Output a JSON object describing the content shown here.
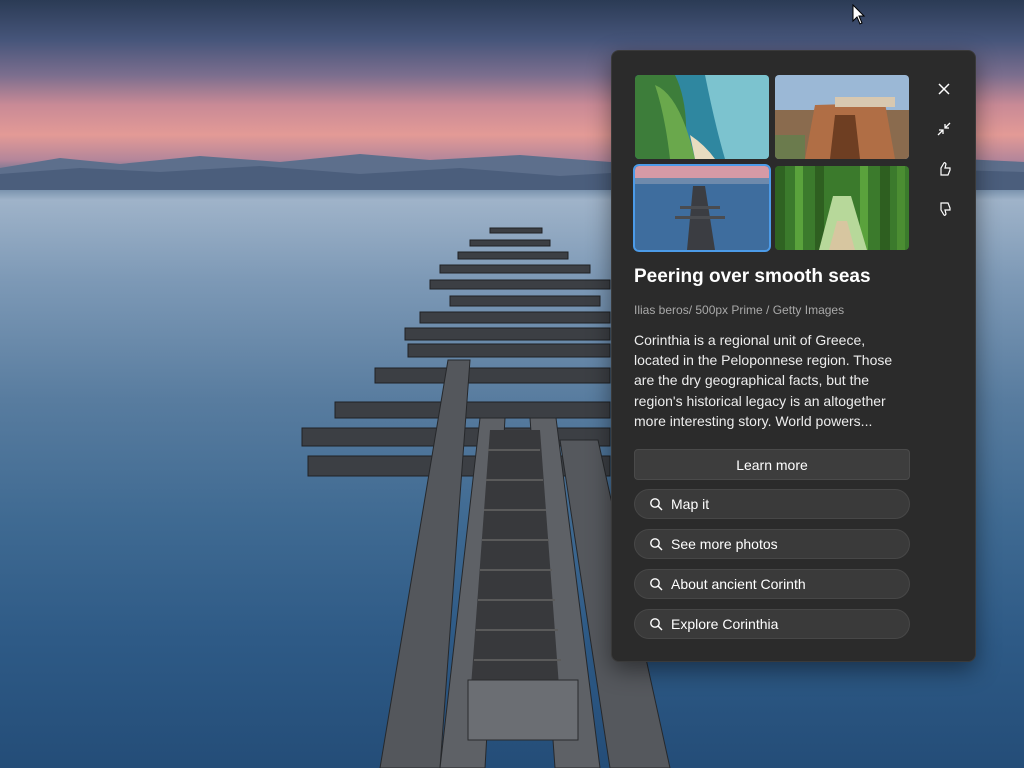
{
  "spotlight": {
    "thumbnails": [
      {
        "name": "coastline",
        "selected": false
      },
      {
        "name": "cliff-town",
        "selected": false
      },
      {
        "name": "pier-seascape",
        "selected": true
      },
      {
        "name": "bamboo-forest",
        "selected": false
      }
    ],
    "side_actions": [
      "close-icon",
      "collapse-icon",
      "thumbs-up-icon",
      "thumbs-down-icon"
    ],
    "title": "Peering over smooth seas",
    "credit": "Ilias beros/ 500px Prime / Getty Images",
    "description": "Corinthia is a regional unit of Greece, located in the Peloponnese region. Those are the dry geographical facts, but the region's historical legacy is an altogether more interesting story. World powers...",
    "learn_more_label": "Learn more",
    "suggestions": [
      {
        "label": "Map it"
      },
      {
        "label": "See more photos"
      },
      {
        "label": "About ancient Corinth"
      },
      {
        "label": "Explore Corinthia"
      }
    ]
  },
  "colors": {
    "panel_bg": "#2b2b2b",
    "selected_outline": "#4c9be8",
    "button_bg": "#3d3d3d"
  }
}
